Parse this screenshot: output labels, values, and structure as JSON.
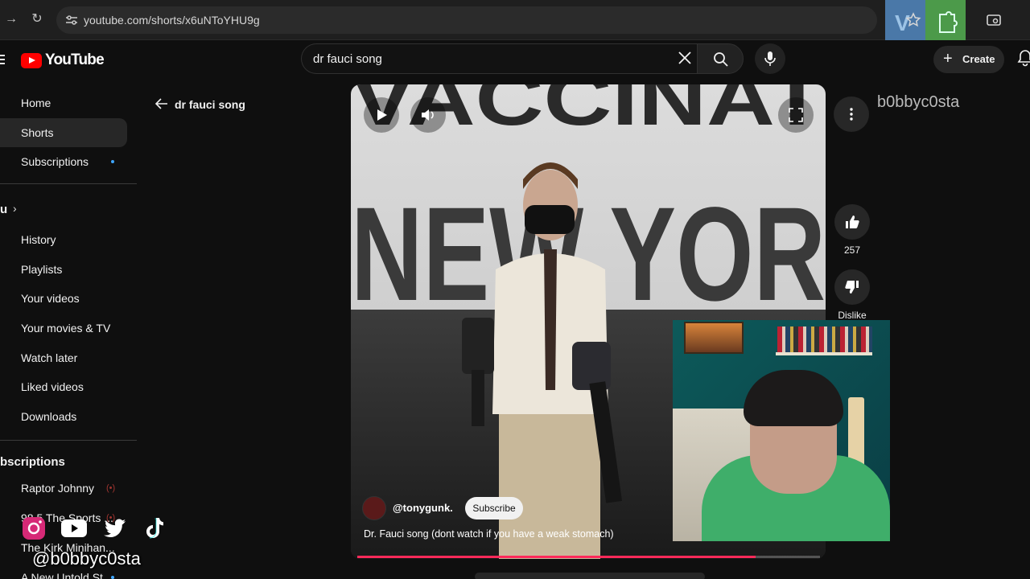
{
  "browser": {
    "url": "youtube.com/shorts/x6uNToYHU9g"
  },
  "header": {
    "logo_text": "YouTube",
    "search_query": "dr fauci song",
    "create_label": "Create",
    "watermark": "b0bbyc0sta"
  },
  "sidebar": {
    "items": [
      {
        "label": "Home"
      },
      {
        "label": "Shorts"
      },
      {
        "label": "Subscriptions"
      },
      {
        "label": "History"
      },
      {
        "label": "Playlists"
      },
      {
        "label": "Your videos"
      },
      {
        "label": "Your movies & TV"
      },
      {
        "label": "Watch later"
      },
      {
        "label": "Liked videos"
      },
      {
        "label": "Downloads"
      }
    ],
    "you_heading": "u",
    "subscriptions_heading": "bscriptions",
    "subscriptions": [
      {
        "label": "Raptor Johnny"
      },
      {
        "label": "98.5 The Sports ..."
      },
      {
        "label": "The Kirk Minihan..."
      },
      {
        "label": "A New Untold St..."
      }
    ]
  },
  "back_link": {
    "label": "dr fauci song"
  },
  "short": {
    "banner_line1": "VACCINAT",
    "banner_line2": "NEW YOR",
    "channel": "@tonygunk.",
    "subscribe_label": "Subscribe",
    "title": "Dr. Fauci song (dont watch if you have a weak stomach)",
    "likes": "257",
    "dislike_label": "Dislike",
    "progress": 0.86
  },
  "overlay": {
    "handle": "@b0bbyc0sta",
    "icons": [
      "instagram-icon",
      "youtube-icon",
      "twitter-icon",
      "tiktok-icon"
    ]
  },
  "colors": {
    "accent": "#ff0000",
    "progress": "#ff2a5a",
    "link_dot": "#3ea6ff"
  }
}
